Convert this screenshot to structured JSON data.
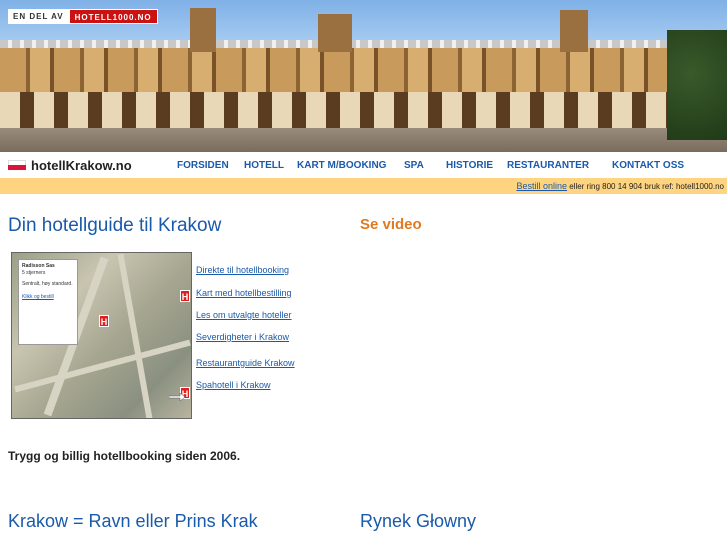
{
  "banner": {
    "badge_prefix": "EN DEL AV",
    "badge_brand": "HOTELL1000.NO"
  },
  "header": {
    "logo_text": "hotellKrakow.no",
    "nav": [
      "FORSIDEN",
      "HOTELL",
      "KART M/BOOKING",
      "SPA",
      "HISTORIE",
      "RESTAURANTER",
      "KONTAKT OSS"
    ]
  },
  "infobar": {
    "link": "Bestill online",
    "text": " eller ring 800 14 904 bruk ref: hotell1000.no"
  },
  "main": {
    "title": "Din hotellguide til Krakow",
    "video_heading": "Se video",
    "map_card": {
      "name": "Radisson Sas",
      "stars": "5 stjerners",
      "desc": "Sentralt, høy standard.",
      "link": "Klikk og bestill"
    },
    "links": [
      "Direkte til hotellbooking",
      "Kart med hotellbestilling",
      "Les om utvalgte hoteller",
      "Severdigheter i Krakow",
      "Restaurantguide Krakow",
      "Spahotell i Krakow"
    ],
    "tagline": "Trygg og billig hotellbooking siden 2006.",
    "section_left": "Krakow = Ravn eller Prins Krak",
    "section_right": "Rynek Głowny"
  },
  "colors": {
    "link_blue": "#1a5aaa",
    "accent_orange": "#e07a20",
    "infobar_bg": "#ffd480",
    "brand_red": "#cc1111"
  }
}
